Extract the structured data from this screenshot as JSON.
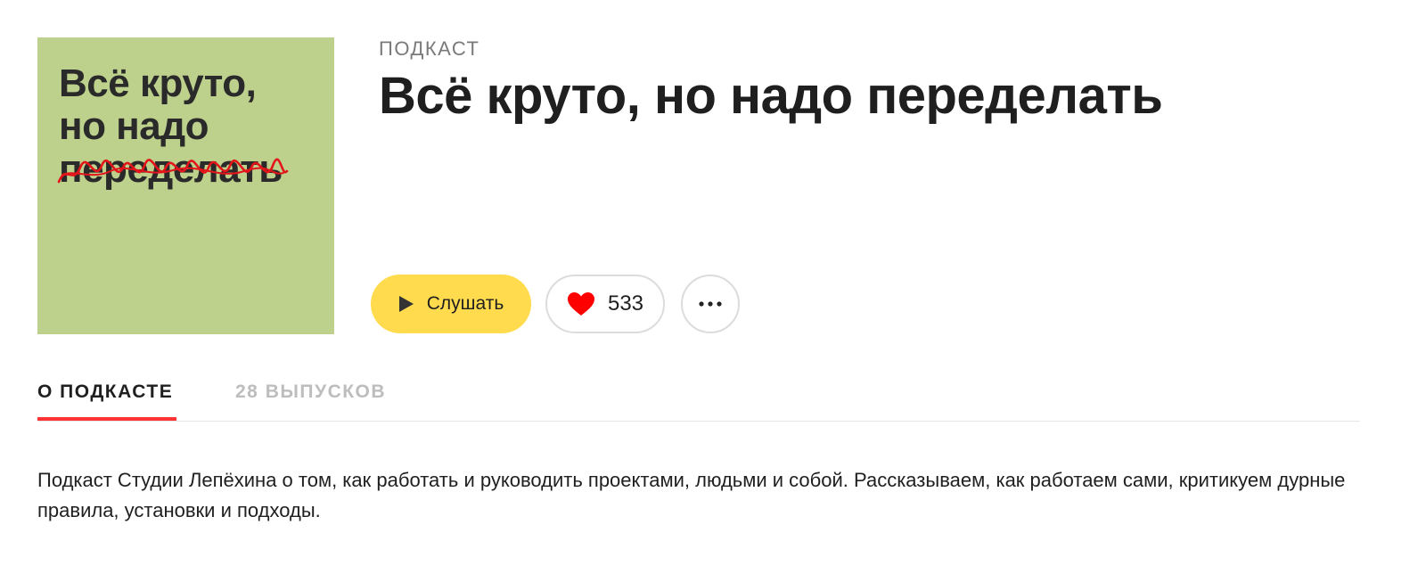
{
  "cover": {
    "line1": "Всё круто,",
    "line2": "но надо",
    "line3": "переделать",
    "background_color": "#bdd18c"
  },
  "header": {
    "kind_label": "ПОДКАСТ",
    "title": "Всё круто, но надо переделать"
  },
  "actions": {
    "listen_label": "Слушать",
    "listen_icon": "play-icon",
    "like_icon": "heart-icon",
    "like_count": "533",
    "more_icon": "more-dots-icon"
  },
  "tabs": [
    {
      "label": "О ПОДКАСТЕ",
      "active": true
    },
    {
      "label": "28 ВЫПУСКОВ",
      "active": false
    }
  ],
  "description": "Подкаст Студии Лепёхина о том, как работать и руководить проектами, людьми и собой. Рассказываем, как работаем сами, критикуем дурные правила, установки и подходы.",
  "colors": {
    "accent_yellow": "#ffdb4d",
    "like_red": "#ff0000",
    "tab_indicator": "#ff3333"
  }
}
